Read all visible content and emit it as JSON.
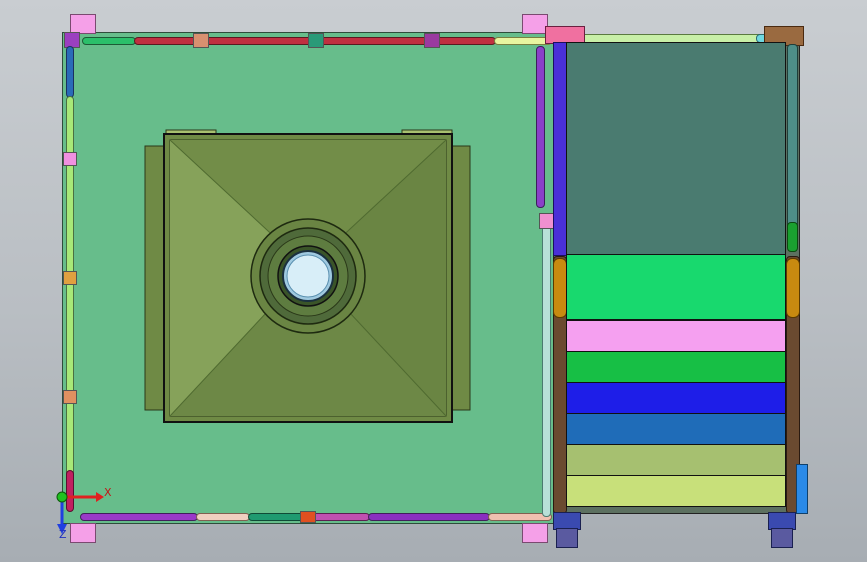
{
  "viewport": {
    "background_top": "#c9cdd1",
    "background_bottom": "#a7adb3"
  },
  "triad": {
    "x_label": "X",
    "z_label": "Z",
    "x_color": "#e02020",
    "y_color": "#20b020",
    "z_color": "#2040e0"
  },
  "colors": {
    "panel_green": "#67bd8b",
    "box_olive": "#6f8a45",
    "box_olive_light": "#88a05a",
    "teal_block": "#4a7b70",
    "stack": [
      "#18d96e",
      "#f5a0f0",
      "#17bf45",
      "#1e1ee8",
      "#1f6cb8",
      "#a6c070",
      "#c8e07a"
    ],
    "rail_brown": "#6a4a30",
    "hole_ring": "#4f6a3a",
    "hole_center": "#9fc9e0"
  },
  "model": {
    "parts": [
      "main-panel",
      "square-hopper",
      "center-opening",
      "right-cabinet",
      "teal-module",
      "layer-stack",
      "frame-rails"
    ]
  }
}
